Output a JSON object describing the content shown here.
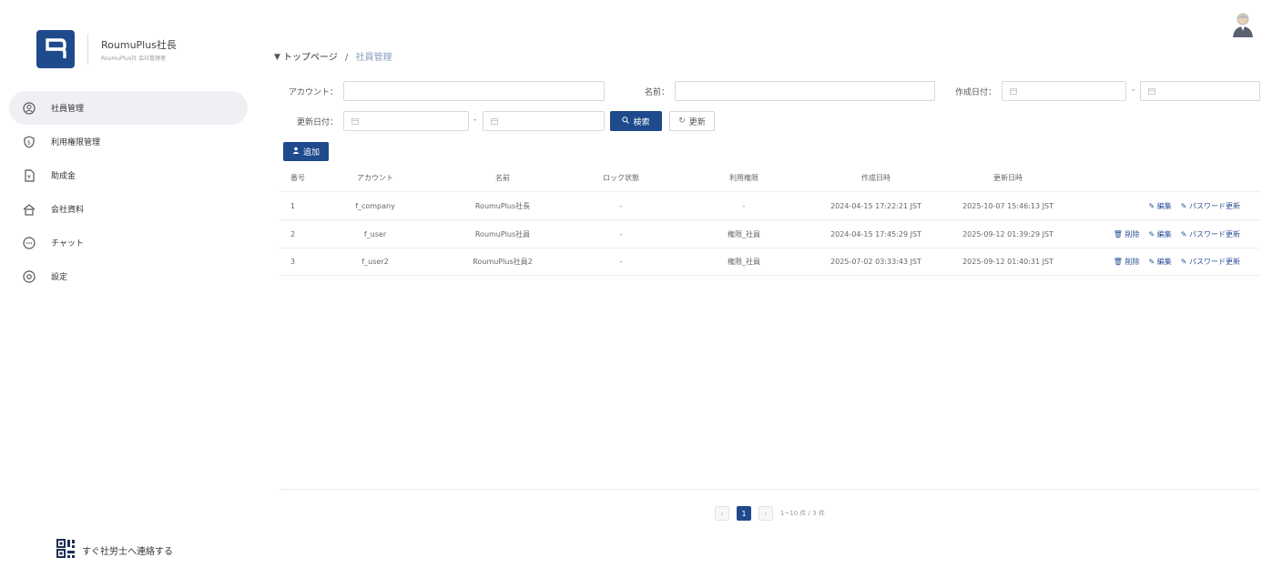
{
  "brand": {
    "name": "RoumuPlus社長",
    "sub": "RoumuPlus社 会社管理者"
  },
  "nav": [
    {
      "label": "社員管理",
      "icon": "employee-icon"
    },
    {
      "label": "利用権限管理",
      "icon": "shield-icon"
    },
    {
      "label": "助成金",
      "icon": "document-icon"
    },
    {
      "label": "会社資料",
      "icon": "company-icon"
    },
    {
      "label": "チャット",
      "icon": "chat-icon"
    },
    {
      "label": "設定",
      "icon": "settings-icon"
    }
  ],
  "contact_label": "すぐ社労士へ連絡する",
  "breadcrumb": {
    "home": "トップページ",
    "sep": "/",
    "current": "社員管理"
  },
  "search": {
    "account_label": "アカウント：",
    "name_label": "名前：",
    "created_label": "作成日付：",
    "updated_label": "更新日付：",
    "search_button": "検索",
    "reset_button": "更新",
    "add_button": "追加"
  },
  "table": {
    "headers": [
      "番号",
      "アカウント",
      "名前",
      "ロック状態",
      "利用権限",
      "作成日時",
      "更新日時"
    ],
    "rows": [
      {
        "no": "1",
        "account": "f_company",
        "name": "RoumuPlus社長",
        "lock": "-",
        "role": "-",
        "created": "2024-04-15 17:22:21 JST",
        "updated": "2025-10-07 15:46:13 JST",
        "actions": [
          "編集",
          "パスワード更新"
        ]
      },
      {
        "no": "2",
        "account": "f_user",
        "name": "RoumuPlus社員",
        "lock": "-",
        "role": "権限_社員",
        "created": "2024-04-15 17:45:29 JST",
        "updated": "2025-09-12 01:39:29 JST",
        "actions": [
          "削除",
          "編集",
          "パスワード更新"
        ]
      },
      {
        "no": "3",
        "account": "f_user2",
        "name": "RoumuPlus社員2",
        "lock": "-",
        "role": "権限_社員",
        "created": "2025-07-02 03:33:43 JST",
        "updated": "2025-09-12 01:40:31 JST",
        "actions": [
          "削除",
          "編集",
          "パスワード更新"
        ]
      }
    ]
  },
  "pagination": {
    "current": "1",
    "info": "1~10 件 / 3 件"
  },
  "colors": {
    "primary": "#1f4a8c",
    "active_bg": "#eef0f4"
  }
}
